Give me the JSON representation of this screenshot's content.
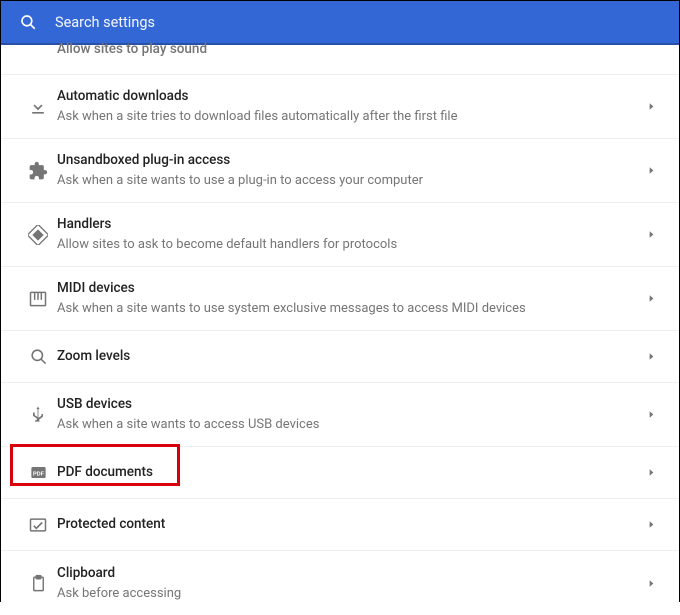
{
  "header": {
    "search_placeholder": "Search settings"
  },
  "rows": [
    {
      "icon": "sound",
      "title": "Allow sites to play sound",
      "subtitle": "",
      "truncated": true
    },
    {
      "icon": "download",
      "title": "Automatic downloads",
      "subtitle": "Ask when a site tries to download files automatically after the first file"
    },
    {
      "icon": "puzzle",
      "title": "Unsandboxed plug-in access",
      "subtitle": "Ask when a site wants to use a plug-in to access your computer"
    },
    {
      "icon": "handlers",
      "title": "Handlers",
      "subtitle": "Allow sites to ask to become default handlers for protocols"
    },
    {
      "icon": "midi",
      "title": "MIDI devices",
      "subtitle": "Ask when a site wants to use system exclusive messages to access MIDI devices"
    },
    {
      "icon": "zoom",
      "title": "Zoom levels",
      "subtitle": ""
    },
    {
      "icon": "usb",
      "title": "USB devices",
      "subtitle": "Ask when a site wants to access USB devices"
    },
    {
      "icon": "pdf",
      "title": "PDF documents",
      "subtitle": "",
      "highlight": true
    },
    {
      "icon": "protected",
      "title": "Protected content",
      "subtitle": ""
    },
    {
      "icon": "clipboard",
      "title": "Clipboard",
      "subtitle": "Ask before accessing"
    }
  ]
}
